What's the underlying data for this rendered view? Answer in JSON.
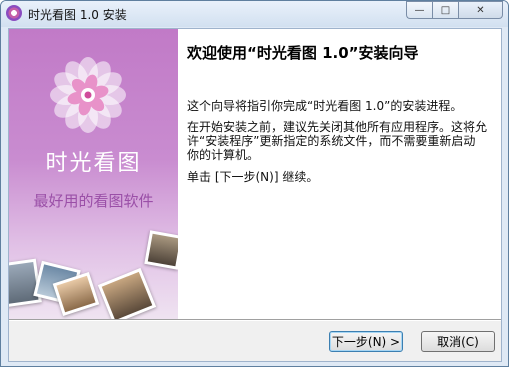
{
  "window": {
    "title": "时光看图 1.0 安装",
    "controls": {
      "minimize": "—",
      "maximize": "□",
      "close": "✕"
    }
  },
  "banner": {
    "brand": "时光看图",
    "slogan": "最好用的看图软件",
    "accent_color": "#c17ac7"
  },
  "content": {
    "heading": "欢迎使用“时光看图 1.0”安装向导",
    "para1": "这个向导将指引你完成“时光看图 1.0”的安装进程。",
    "para2": "在开始安装之前，建议先关闭其他所有应用程序。这将允许“安装程序”更新指定的系统文件，而不需要重新启动你的计算机。",
    "para3": "单击 [下一步(N)] 继续。"
  },
  "buttons": {
    "next": "下一步(N) >",
    "cancel": "取消(C)"
  }
}
